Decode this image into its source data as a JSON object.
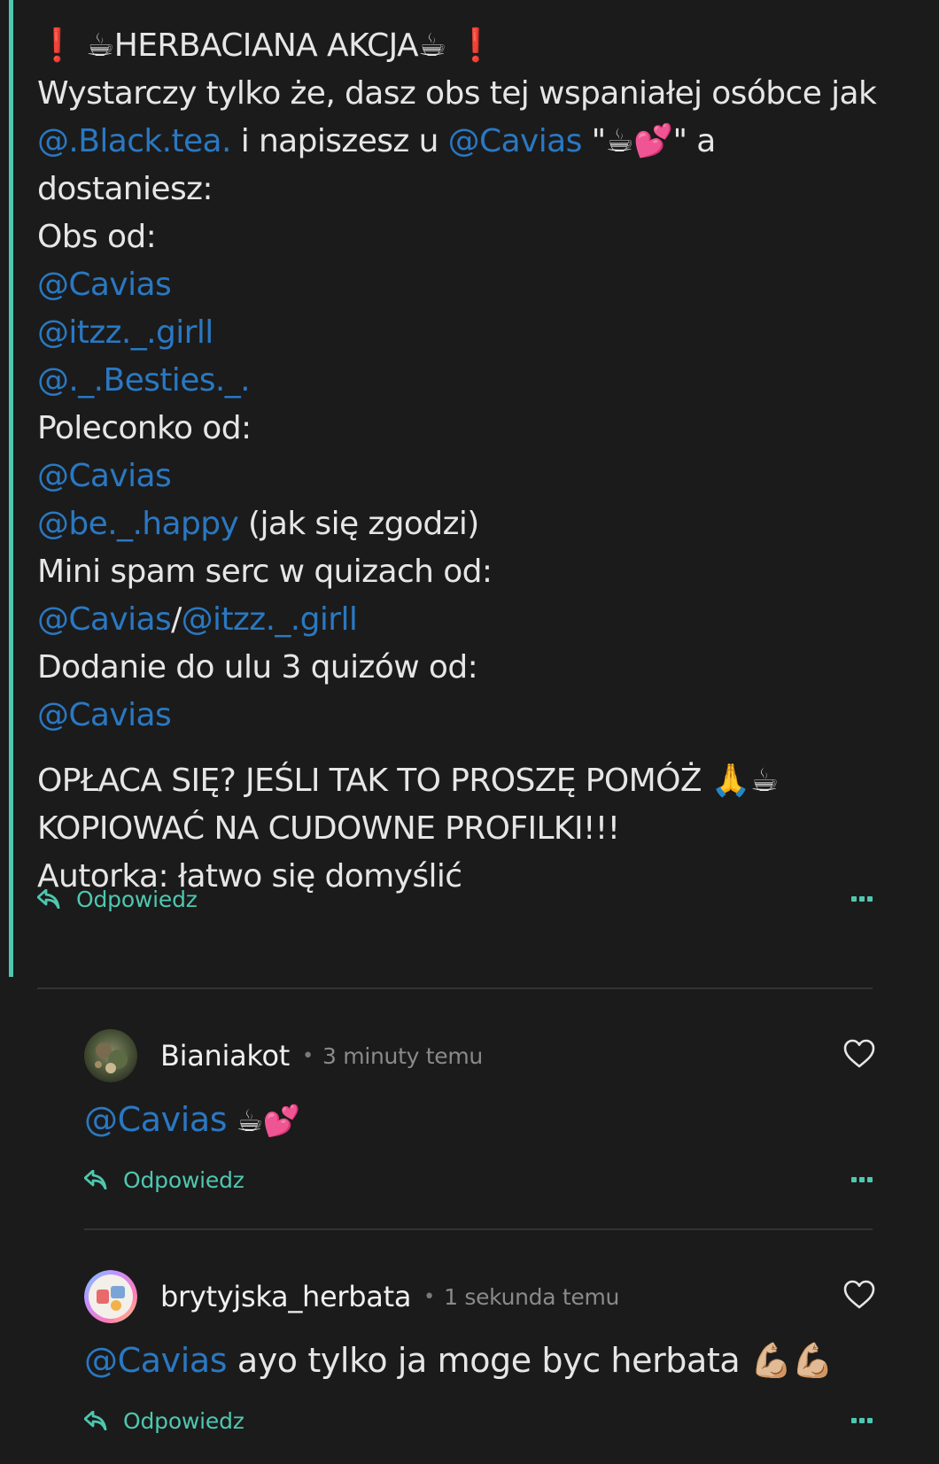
{
  "post": {
    "lines": [
      [
        {
          "t": "❗ ☕HERBACIANA AKCJA☕ ❗"
        }
      ],
      [
        {
          "t": "Wystarczy tylko że, dasz obs tej wspaniałej osóbce jak"
        }
      ],
      [
        {
          "t": "@.Black.tea.",
          "m": true
        },
        {
          "t": " i napiszesz u "
        },
        {
          "t": "@Cavias",
          "m": true
        },
        {
          "t": " \"☕💕\" a"
        }
      ],
      [
        {
          "t": "dostaniesz:"
        }
      ],
      [
        {
          "t": "Obs od:"
        }
      ],
      [
        {
          "t": "@Cavias",
          "m": true
        }
      ],
      [
        {
          "t": "@itzz._.girll",
          "m": true
        }
      ],
      [
        {
          "t": "@._.Besties._.",
          "m": true
        }
      ],
      [
        {
          "t": "Poleconko od:"
        }
      ],
      [
        {
          "t": "@Cavias",
          "m": true
        }
      ],
      [
        {
          "t": "@be._.happy",
          "m": true
        },
        {
          "t": " (jak się zgodzi)"
        }
      ],
      [
        {
          "t": "Mini spam serc w quizach od:"
        }
      ],
      [
        {
          "t": "@Cavias",
          "m": true
        },
        {
          "t": "/"
        },
        {
          "t": "@itzz._.girll",
          "m": true
        }
      ],
      [
        {
          "t": "Dodanie do ulu 3 quizów od:"
        }
      ],
      [
        {
          "t": "@Cavias",
          "m": true
        }
      ],
      [],
      [
        {
          "t": "OPŁACA SIĘ? JEŚLI TAK TO PROSZĘ POMÓŻ 🙏☕"
        }
      ],
      [
        {
          "t": "KOPIOWAĆ NA CUDOWNE PROFILKI!!!"
        }
      ],
      [
        {
          "t": "Autorka: łatwo się domyślić"
        }
      ]
    ],
    "reply_label": "Odpowiedz",
    "more_icon": "more-dots-icon"
  },
  "comments": [
    {
      "user": "Bianiakot",
      "separator": "•",
      "time": "3 minuty temu",
      "mention": "@Cavias",
      "text": " ☕💕",
      "reply_label": "Odpowiedz"
    },
    {
      "user": "brytyjska_herbata",
      "separator": "•",
      "time": "1 sekunda temu",
      "mention": "@Cavias",
      "text": " ayo tylko ja moge byc herbata 💪🏼💪🏼",
      "reply_label": "Odpowiedz"
    }
  ],
  "colors": {
    "background": "#1b1b1b",
    "accent": "#4fc7b0",
    "mention": "#2a78c2",
    "text": "#e6e6e6",
    "muted": "#8a8a8a"
  }
}
